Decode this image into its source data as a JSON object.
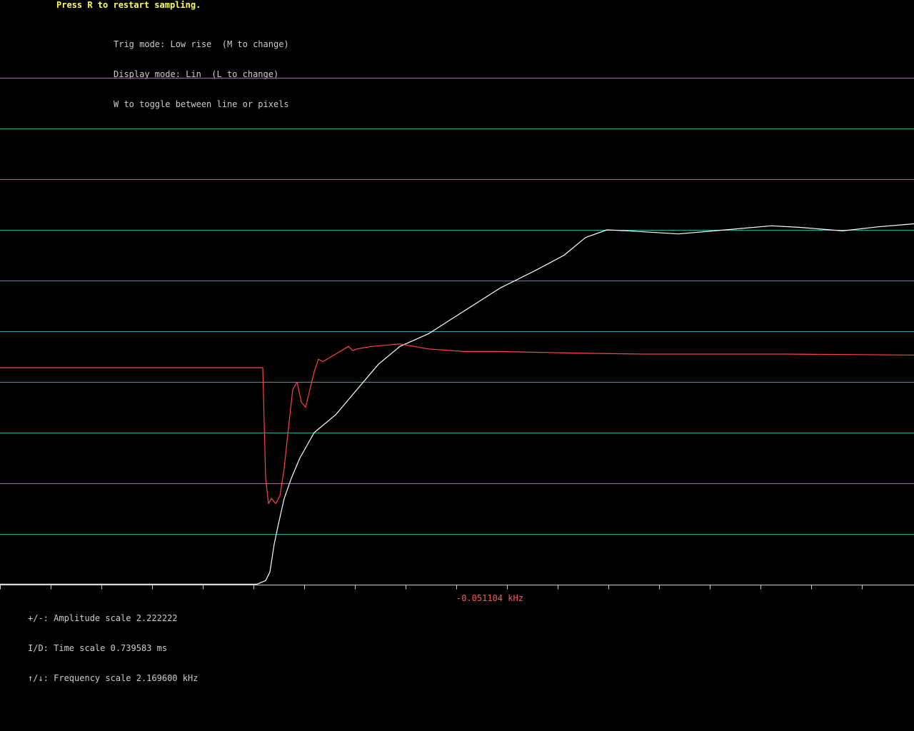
{
  "header": {
    "restart_hint": "Press R to restart sampling.",
    "trig_mode": "Trig mode: Low rise  (M to change)",
    "display_mode": "Display mode: Lin  (L to change)",
    "toggle_hint": "W to toggle between line or pixels"
  },
  "footer": {
    "amplitude_scale": "+/-: Amplitude scale 2.222222",
    "time_scale": "I/D: Time scale 0.739583 ms",
    "frequency_scale": "↑/↓: Frequency scale 2.169600 kHz",
    "frequency_readout": "-0.051104 kHz"
  },
  "colors": {
    "background": "#000000",
    "grid": "#2aa3b0",
    "axis": "#cccccc",
    "trace_white": "#ffffff",
    "trace_red": "#ff4444",
    "hint": "#ffff55",
    "readout": "#ff5555"
  },
  "chart_data": {
    "type": "line",
    "grid": true,
    "horizontal_gridlines": 10,
    "x_ticks": 18,
    "ylim": [
      0,
      10
    ],
    "xlim": [
      0,
      1280
    ],
    "series": [
      {
        "color": "#ffffff",
        "x": [
          0,
          360,
          372,
          378,
          384,
          390,
          398,
          408,
          420,
          440,
          470,
          500,
          530,
          560,
          600,
          650,
          700,
          750,
          790,
          820,
          850,
          880,
          950,
          1000,
          1080,
          1120,
          1180,
          1230,
          1280
        ],
        "y": [
          0.01,
          0.01,
          0.08,
          0.25,
          0.8,
          1.2,
          1.7,
          2.1,
          2.5,
          3.0,
          3.35,
          3.85,
          4.35,
          4.7,
          4.95,
          5.4,
          5.85,
          6.2,
          6.5,
          6.85,
          7.0,
          6.98,
          6.92,
          6.98,
          7.08,
          7.05,
          6.98,
          7.06,
          7.12
        ]
      },
      {
        "color": "#ff4444",
        "x": [
          0,
          368,
          372,
          376,
          380,
          386,
          392,
          398,
          404,
          410,
          416,
          422,
          428,
          434,
          440,
          446,
          452,
          458,
          464,
          470,
          476,
          482,
          488,
          494,
          500,
          520,
          560,
          600,
          650,
          700,
          800,
          900,
          1000,
          1100,
          1280
        ],
        "y": [
          4.28,
          4.28,
          2.1,
          1.6,
          1.7,
          1.6,
          1.75,
          2.3,
          3.1,
          3.85,
          4.0,
          3.6,
          3.5,
          3.85,
          4.2,
          4.45,
          4.4,
          4.45,
          4.5,
          4.55,
          4.6,
          4.65,
          4.7,
          4.62,
          4.65,
          4.7,
          4.75,
          4.65,
          4.6,
          4.6,
          4.57,
          4.55,
          4.55,
          4.55,
          4.53
        ]
      }
    ]
  }
}
